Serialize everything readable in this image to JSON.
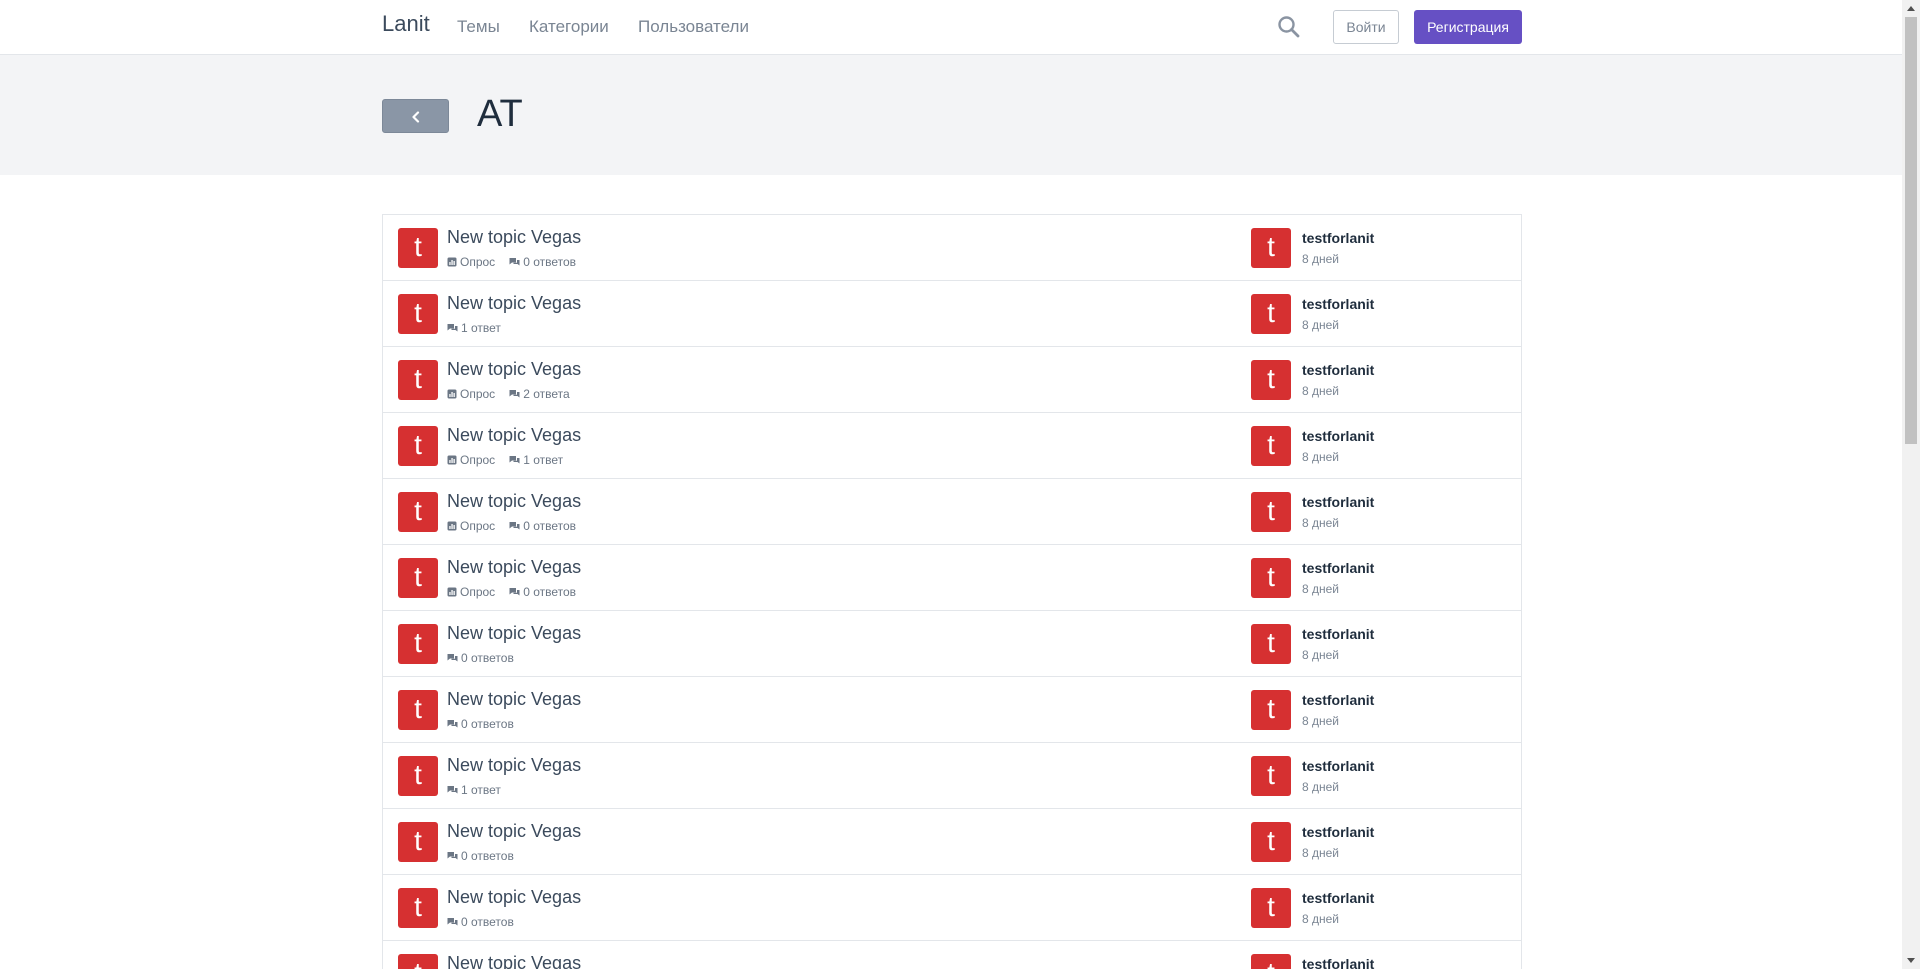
{
  "header": {
    "brand": "Lanit",
    "nav": [
      {
        "label": "Темы"
      },
      {
        "label": "Категории"
      },
      {
        "label": "Пользователи"
      }
    ],
    "login_label": "Войти",
    "register_label": "Регистрация"
  },
  "category": {
    "title": "AT"
  },
  "topics": [
    {
      "avatar_letter": "t",
      "title": "New topic Vegas",
      "poll": "Опрос",
      "replies": "0 ответов",
      "user": "testforlanit",
      "time": "8 дней",
      "user_avatar": "t"
    },
    {
      "avatar_letter": "t",
      "title": "New topic Vegas",
      "poll": "",
      "replies": "1 ответ",
      "user": "testforlanit",
      "time": "8 дней",
      "user_avatar": "t"
    },
    {
      "avatar_letter": "t",
      "title": "New topic Vegas",
      "poll": "Опрос",
      "replies": "2 ответа",
      "user": "testforlanit",
      "time": "8 дней",
      "user_avatar": "t"
    },
    {
      "avatar_letter": "t",
      "title": "New topic Vegas",
      "poll": "Опрос",
      "replies": "1 ответ",
      "user": "testforlanit",
      "time": "8 дней",
      "user_avatar": "t"
    },
    {
      "avatar_letter": "t",
      "title": "New topic Vegas",
      "poll": "Опрос",
      "replies": "0 ответов",
      "user": "testforlanit",
      "time": "8 дней",
      "user_avatar": "t"
    },
    {
      "avatar_letter": "t",
      "title": "New topic Vegas",
      "poll": "Опрос",
      "replies": "0 ответов",
      "user": "testforlanit",
      "time": "8 дней",
      "user_avatar": "t"
    },
    {
      "avatar_letter": "t",
      "title": "New topic Vegas",
      "poll": "",
      "replies": "0 ответов",
      "user": "testforlanit",
      "time": "8 дней",
      "user_avatar": "t"
    },
    {
      "avatar_letter": "t",
      "title": "New topic Vegas",
      "poll": "",
      "replies": "0 ответов",
      "user": "testforlanit",
      "time": "8 дней",
      "user_avatar": "t"
    },
    {
      "avatar_letter": "t",
      "title": "New topic Vegas",
      "poll": "",
      "replies": "1 ответ",
      "user": "testforlanit",
      "time": "8 дней",
      "user_avatar": "t"
    },
    {
      "avatar_letter": "t",
      "title": "New topic Vegas",
      "poll": "",
      "replies": "0 ответов",
      "user": "testforlanit",
      "time": "8 дней",
      "user_avatar": "t"
    },
    {
      "avatar_letter": "t",
      "title": "New topic Vegas",
      "poll": "",
      "replies": "0 ответов",
      "user": "testforlanit",
      "time": "8 дней",
      "user_avatar": "t"
    },
    {
      "avatar_letter": "t",
      "title": "New topic Vegas",
      "poll": "",
      "replies": "",
      "user": "testforlanit",
      "time": "",
      "user_avatar": "t"
    }
  ],
  "icons": {
    "search": "search-icon",
    "back": "chevron-left-icon",
    "poll": "poll-icon",
    "replies": "comments-icon"
  },
  "colors": {
    "accent": "#6650c4",
    "avatar": "#d63031",
    "back_button": "#8a96a6"
  }
}
